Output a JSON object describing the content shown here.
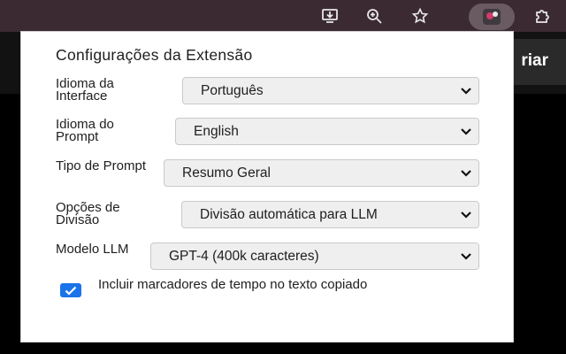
{
  "browser": {
    "background_button_label": "riar",
    "icons": [
      "download-icon",
      "zoom-icon",
      "star-icon",
      "extension-icon",
      "puzzle-icon"
    ]
  },
  "popup": {
    "title": "Configurações da Extensão",
    "fields": [
      {
        "label": "Idioma da Interface",
        "value": "Português"
      },
      {
        "label": "Idioma do Prompt",
        "value": "English"
      },
      {
        "label": "Tipo de Prompt",
        "value": "Resumo Geral"
      },
      {
        "label": "Opções de Divisão",
        "value": "Divisão automática para LLM"
      },
      {
        "label": "Modelo LLM",
        "value": "GPT-4 (400k caracteres)"
      }
    ],
    "checkbox": {
      "label": "Incluir marcadores de tempo no texto copiado",
      "checked": true
    }
  },
  "colors": {
    "toolbar": "#3c2a33",
    "accent": "#1a73e8",
    "select_bg": "#efefef"
  }
}
